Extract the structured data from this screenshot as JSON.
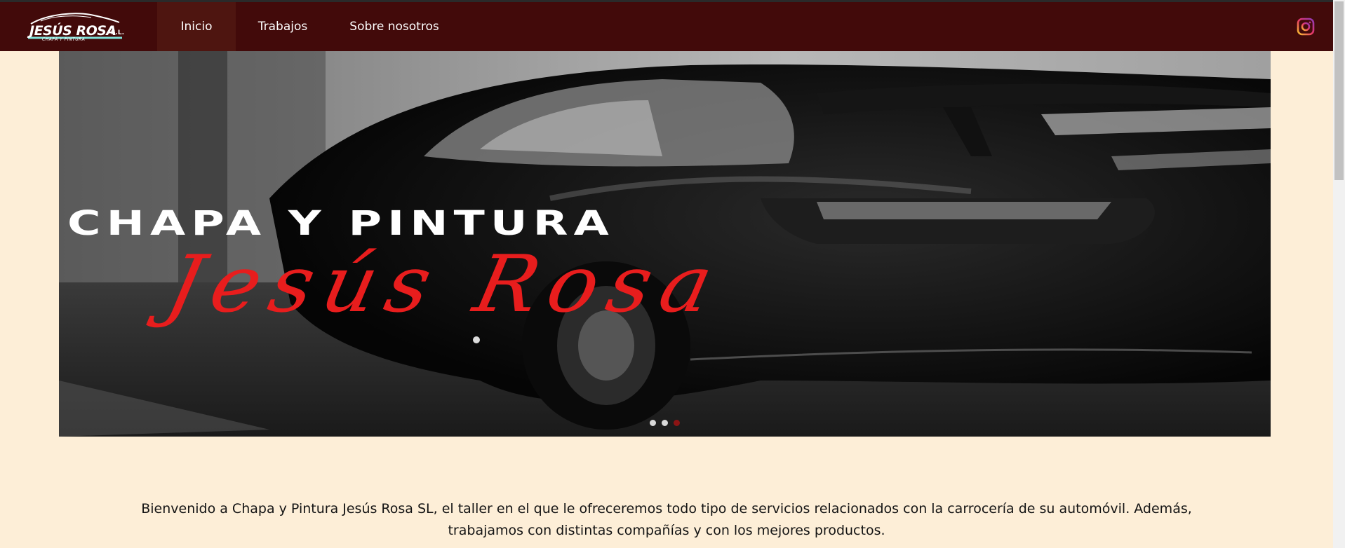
{
  "brand": {
    "logo_name": "JESÚS ROSA",
    "logo_suffix": "S.L.",
    "logo_tagline": "CHAPA Y PINTURA"
  },
  "nav": {
    "items": [
      {
        "label": "Inicio",
        "active": true
      },
      {
        "label": "Trabajos",
        "active": false
      },
      {
        "label": "Sobre nosotros",
        "active": false
      }
    ],
    "social_icon": "instagram-icon"
  },
  "hero": {
    "title": "CHAPA Y PINTURA",
    "script": "Jesús Rosa",
    "slides": 3,
    "active_slide": 3
  },
  "welcome": {
    "text": "Bienvenido a Chapa y Pintura Jesús Rosa SL, el taller en el que le ofreceremos todo tipo de servicios relacionados con la carrocería de su automóvil. Además, trabajamos con distintas compañías y con los mejores productos."
  },
  "colors": {
    "navbar": "#420a0a",
    "page_background": "#fdeed7",
    "script_red": "#e81d1d",
    "active_dot": "#8c1414"
  }
}
